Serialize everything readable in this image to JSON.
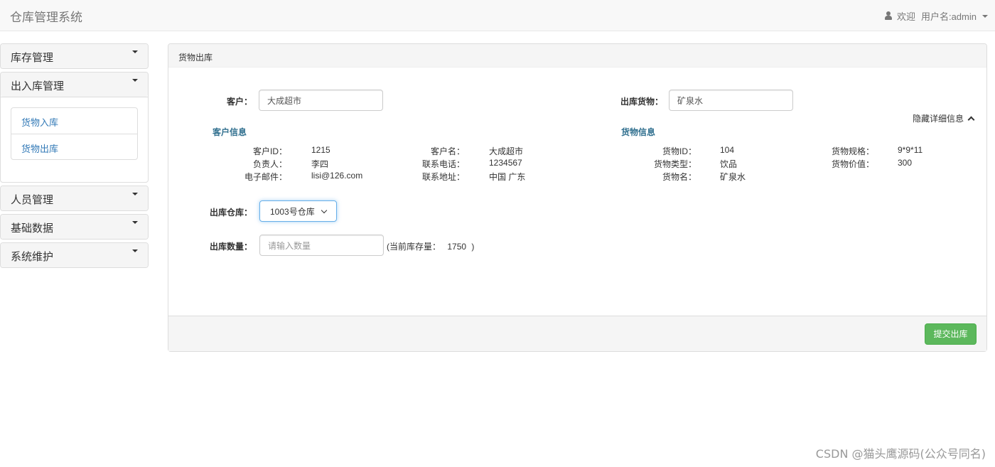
{
  "navbar": {
    "brand": "仓库管理系统",
    "welcome": "欢迎",
    "username": "用户名:admin"
  },
  "sidebar": {
    "items": [
      {
        "label": "库存管理"
      },
      {
        "label": "出入库管理",
        "children": [
          "货物入库",
          "货物出库"
        ]
      },
      {
        "label": "人员管理"
      },
      {
        "label": "基础数据"
      },
      {
        "label": "系统维护"
      }
    ]
  },
  "main": {
    "title": "货物出库",
    "customer_label": "客户：",
    "customer_value": "大成超市",
    "goods_label": "出库货物：",
    "goods_value": "矿泉水",
    "toggle_details": "隐藏详细信息",
    "customer_info": {
      "title": "客户信息",
      "fields": [
        {
          "label": "客户ID：",
          "value": "1215"
        },
        {
          "label": "客户名：",
          "value": "大成超市"
        },
        {
          "label": "负责人：",
          "value": "李四"
        },
        {
          "label": "联系电话：",
          "value": "1234567"
        },
        {
          "label": "电子邮件：",
          "value": "lisi@126.com"
        },
        {
          "label": "联系地址：",
          "value": "中国 广东"
        }
      ]
    },
    "goods_info": {
      "title": "货物信息",
      "fields": [
        {
          "label": "货物ID：",
          "value": "104"
        },
        {
          "label": "货物规格：",
          "value": "9*9*11"
        },
        {
          "label": "货物类型：",
          "value": "饮品"
        },
        {
          "label": "货物价值：",
          "value": "300"
        },
        {
          "label": "货物名：",
          "value": "矿泉水"
        }
      ]
    },
    "warehouse_label": "出库仓库：",
    "warehouse_selected": "1003号仓库",
    "quantity_label": "出库数量：",
    "quantity_placeholder": "请输入数量",
    "stock_note_prefix": "(当前库存量：",
    "stock_value": "1750",
    "stock_note_suffix": ")",
    "submit_label": "提交出库"
  },
  "watermark": "CSDN @猫头鹰源码(公众号同名)",
  "colors": {
    "accent_link": "#337ab7",
    "section_title": "#31708f",
    "submit_button": "#5cb85c"
  }
}
